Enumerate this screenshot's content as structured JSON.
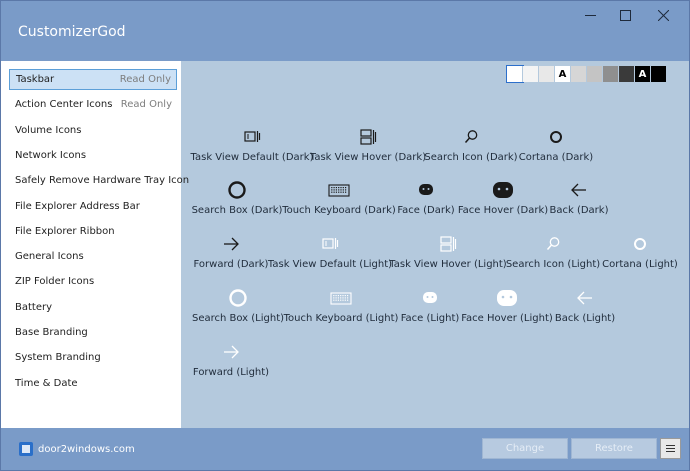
{
  "window": {
    "title": "CustomizerGod",
    "controls": [
      "minimize-icon",
      "maximize-icon",
      "close-icon"
    ]
  },
  "sidebar": {
    "items": [
      {
        "label": "Taskbar",
        "badge": "Read Only",
        "selected": true
      },
      {
        "label": "Action Center Icons",
        "badge": "Read Only"
      },
      {
        "label": "Volume Icons",
        "badge": ""
      },
      {
        "label": "Network Icons",
        "badge": ""
      },
      {
        "label": "Safely Remove Hardware Tray Icon",
        "badge": ""
      },
      {
        "label": "File Explorer Address Bar",
        "badge": ""
      },
      {
        "label": "File Explorer Ribbon",
        "badge": ""
      },
      {
        "label": "General Icons",
        "badge": ""
      },
      {
        "label": "ZIP Folder Icons",
        "badge": ""
      },
      {
        "label": "Battery",
        "badge": ""
      },
      {
        "label": "Base Branding",
        "badge": ""
      },
      {
        "label": "System Branding",
        "badge": ""
      },
      {
        "label": "Time & Date",
        "badge": ""
      }
    ]
  },
  "swatches": [
    {
      "color": "#ffffff",
      "glyph": "",
      "selected": true
    },
    {
      "color": "#f4f4f4",
      "glyph": ""
    },
    {
      "color": "#e8e8e8",
      "glyph": ""
    },
    {
      "color": "#ffffff",
      "glyph": "A",
      "glyph_color": "#000000"
    },
    {
      "color": "#d6d6d6",
      "glyph": ""
    },
    {
      "color": "#c4c4c4",
      "glyph": ""
    },
    {
      "color": "#8f8f8f",
      "glyph": ""
    },
    {
      "color": "#3a3a3a",
      "glyph": ""
    },
    {
      "color": "#000000",
      "glyph": "A",
      "glyph_color": "#ffffff"
    },
    {
      "color": "#000000",
      "glyph": ""
    }
  ],
  "icons": [
    {
      "label": "Task View Default (Dark)",
      "icon": "task-view-icon",
      "theme": "dark"
    },
    {
      "label": "Task View Hover (Dark)",
      "icon": "task-view-hover-icon",
      "theme": "dark"
    },
    {
      "label": "Search Icon (Dark)",
      "icon": "search-icon",
      "theme": "dark"
    },
    {
      "label": "Cortana (Dark)",
      "icon": "cortana-icon",
      "theme": "dark"
    },
    {
      "label": "Search Box (Dark)",
      "icon": "search-box-icon",
      "theme": "dark"
    },
    {
      "label": "Touch Keyboard (Dark)",
      "icon": "keyboard-icon",
      "theme": "dark"
    },
    {
      "label": "Face (Dark)",
      "icon": "face-icon",
      "theme": "dark"
    },
    {
      "label": "Face Hover (Dark)",
      "icon": "face-hover-icon",
      "theme": "dark"
    },
    {
      "label": "Back (Dark)",
      "icon": "back-arrow-icon",
      "theme": "dark"
    },
    {
      "label": "Forward (Dark)",
      "icon": "forward-arrow-icon",
      "theme": "dark"
    },
    {
      "label": "Task View Default (Light)",
      "icon": "task-view-icon",
      "theme": "light"
    },
    {
      "label": "Task View Hover (Light)",
      "icon": "task-view-hover-icon",
      "theme": "light"
    },
    {
      "label": "Search Icon (Light)",
      "icon": "search-icon",
      "theme": "light"
    },
    {
      "label": "Cortana (Light)",
      "icon": "cortana-icon",
      "theme": "light"
    },
    {
      "label": "Search Box (Light)",
      "icon": "search-box-icon",
      "theme": "light"
    },
    {
      "label": "Touch Keyboard (Light)",
      "icon": "keyboard-icon",
      "theme": "light"
    },
    {
      "label": "Face (Light)",
      "icon": "face-icon",
      "theme": "light"
    },
    {
      "label": "Face Hover (Light)",
      "icon": "face-hover-icon",
      "theme": "light"
    },
    {
      "label": "Back (Light)",
      "icon": "back-arrow-icon",
      "theme": "light"
    },
    {
      "label": "Forward (Light)",
      "icon": "forward-arrow-icon",
      "theme": "light"
    }
  ],
  "footer": {
    "brand": "door2windows.com",
    "change_label": "Change",
    "restore_label": "Restore",
    "menu_icon": "hamburger-icon"
  },
  "colors": {
    "titlebar": "#7a9bc8",
    "content_bg": "#b4c9dd",
    "selection": "#cce1f5",
    "selection_border": "#5c9fd8",
    "dark_icon": "#1a1a1a",
    "light_icon": "#ffffff"
  }
}
